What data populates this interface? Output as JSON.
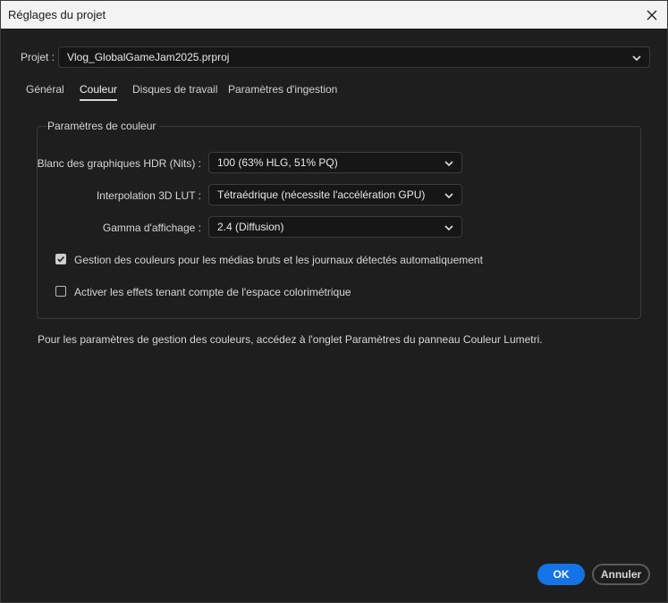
{
  "window": {
    "title": "Réglages du projet",
    "close_icon": "close-icon"
  },
  "project": {
    "label": "Projet :",
    "value": "Vlog_GlobalGameJam2025.prproj"
  },
  "tabs": [
    {
      "label": "Général",
      "active": false
    },
    {
      "label": "Couleur",
      "active": true
    },
    {
      "label": "Disques de travail",
      "active": false
    },
    {
      "label": "Paramètres d'ingestion",
      "active": false
    }
  ],
  "color_settings": {
    "group_title": "Paramètres de couleur",
    "hdr_white": {
      "label": "Blanc des graphiques HDR (Nits) :",
      "value": "100 (63% HLG, 51% PQ)"
    },
    "lut_interp": {
      "label": "Interpolation 3D LUT :",
      "value": "Tétraédrique (nécessite l'accélération GPU)"
    },
    "display_gamma": {
      "label": "Gamma d'affichage :",
      "value": "2.4 (Diffusion)"
    },
    "auto_color_mgmt": {
      "label": "Gestion des couleurs pour les médias bruts et les journaux détectés automatiquement",
      "checked": true
    },
    "color_space_effects": {
      "label": "Activer les effets tenant compte de l'espace colorimétrique",
      "checked": false
    }
  },
  "note": "Pour les paramètres de gestion des couleurs, accédez à l'onglet Paramètres du panneau Couleur Lumetri.",
  "buttons": {
    "ok": "OK",
    "cancel": "Annuler"
  },
  "colors": {
    "accent": "#1473e6",
    "background": "#1e1e1e",
    "titlebar": "#f3f3f3"
  }
}
